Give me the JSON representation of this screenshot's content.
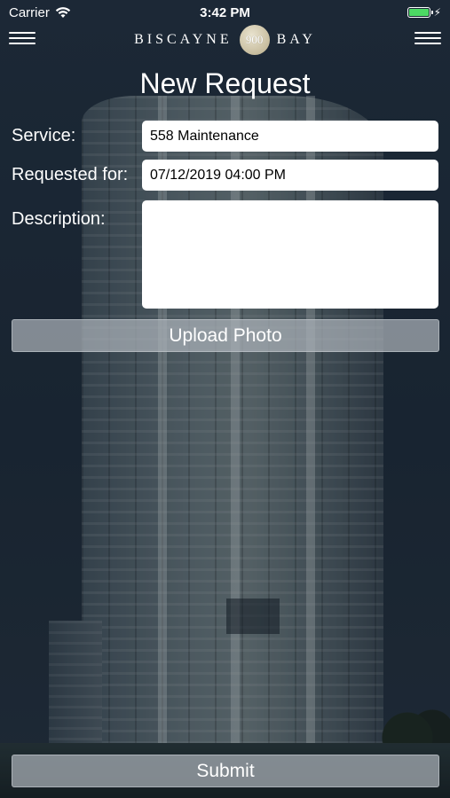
{
  "status_bar": {
    "carrier": "Carrier",
    "time": "3:42 PM",
    "battery_color": "#4cd964",
    "battery_level": 1.0
  },
  "header": {
    "logo_left": "BISCAYNE",
    "logo_badge": "900",
    "logo_right": "BAY",
    "left_menu_icon": "hamburger-icon",
    "right_menu_icon": "hamburger-icon"
  },
  "page": {
    "title": "New Request"
  },
  "form": {
    "service_label": "Service:",
    "service_value": "558 Maintenance",
    "requested_for_label": "Requested for:",
    "requested_for_value": "07/12/2019 04:00 PM",
    "description_label": "Description:",
    "description_value": "",
    "upload_label": "Upload Photo",
    "submit_label": "Submit"
  }
}
